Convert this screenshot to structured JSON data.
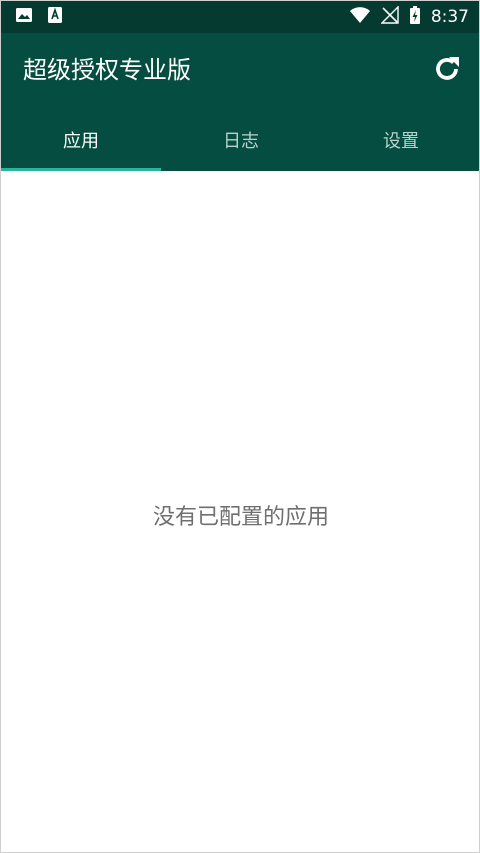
{
  "status_bar": {
    "time": "8:37",
    "left_icons": [
      "image-icon",
      "text-notification-icon"
    ],
    "right_icons": [
      "wifi-icon",
      "no-signal-icon",
      "battery-charging-icon"
    ]
  },
  "app_bar": {
    "title": "超级授权专业版",
    "refresh_icon": "refresh-icon",
    "colors": {
      "status_bar": "#053a30",
      "app_bar": "#054d40",
      "indicator": "#2bb39b"
    }
  },
  "tabs": [
    {
      "label": "应用",
      "active": true
    },
    {
      "label": "日志",
      "active": false
    },
    {
      "label": "设置",
      "active": false
    }
  ],
  "content": {
    "empty_message": "没有已配置的应用"
  }
}
